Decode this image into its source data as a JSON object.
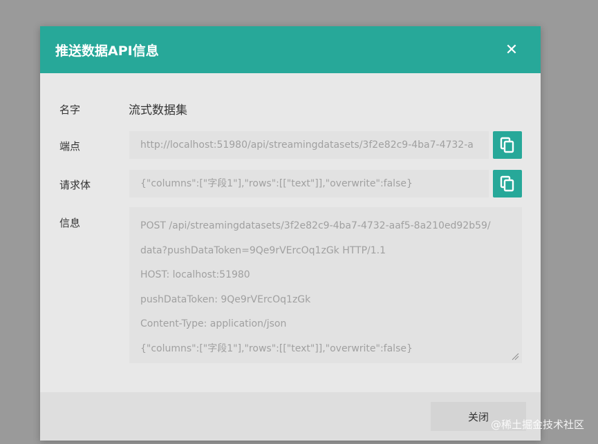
{
  "dialog": {
    "title": "推送数据API信息",
    "close_symbol": "✕",
    "icons": {
      "close": "close-icon",
      "copy": "copy-icon",
      "resize": "resize-grip-icon"
    },
    "colors": {
      "header": "#27a899",
      "body": "#e8e8e8",
      "field": "#e2e2e2",
      "overlay": "#9a9a9a"
    }
  },
  "fields": {
    "name": {
      "label": "名字",
      "value": "流式数据集"
    },
    "endpoint": {
      "label": "端点",
      "value": "http://localhost:51980/api/streamingdatasets/3f2e82c9-4ba7-4732-a"
    },
    "request_body": {
      "label": "请求体",
      "value": "{\"columns\":[\"字段1\"],\"rows\":[[\"text\"]],\"overwrite\":false}"
    },
    "info": {
      "label": "信息",
      "lines": [
        "POST /api/streamingdatasets/3f2e82c9-4ba7-4732-aaf5-8a210ed92b59/",
        "data?pushDataToken=9Qe9rVErcOq1zGk HTTP/1.1",
        "HOST: localhost:51980",
        "pushDataToken: 9Qe9rVErcOq1zGk",
        "Content-Type: application/json",
        "{\"columns\":[\"字段1\"],\"rows\":[[\"text\"]],\"overwrite\":false}"
      ]
    }
  },
  "footer": {
    "close_label": "关闭"
  },
  "watermark": "@稀土掘金技术社区"
}
